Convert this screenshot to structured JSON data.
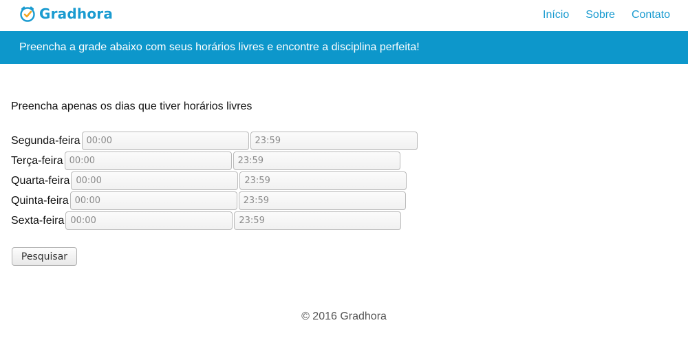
{
  "brand": {
    "name": "Gradhora",
    "icon": "clock-check-icon",
    "color": "#1a9bd0"
  },
  "nav": {
    "items": [
      {
        "label": "Início"
      },
      {
        "label": "Sobre"
      },
      {
        "label": "Contato"
      }
    ]
  },
  "banner": {
    "text": "Preencha a grade abaixo com seus horários livres e encontre a disciplina perfeita!",
    "color": "#0d97cb"
  },
  "form": {
    "instructions": "Preencha apenas os dias que tiver horários livres",
    "days": [
      {
        "label": "Segunda-feira",
        "start_placeholder": "00:00",
        "end_placeholder": "23:59"
      },
      {
        "label": "Terça-feira",
        "start_placeholder": "00:00",
        "end_placeholder": "23:59"
      },
      {
        "label": "Quarta-feira",
        "start_placeholder": "00:00",
        "end_placeholder": "23:59"
      },
      {
        "label": "Quinta-feira",
        "start_placeholder": "00:00",
        "end_placeholder": "23:59"
      },
      {
        "label": "Sexta-feira",
        "start_placeholder": "00:00",
        "end_placeholder": "23:59"
      }
    ],
    "submit_label": "Pesquisar"
  },
  "footer": {
    "text": "© 2016 Gradhora"
  }
}
